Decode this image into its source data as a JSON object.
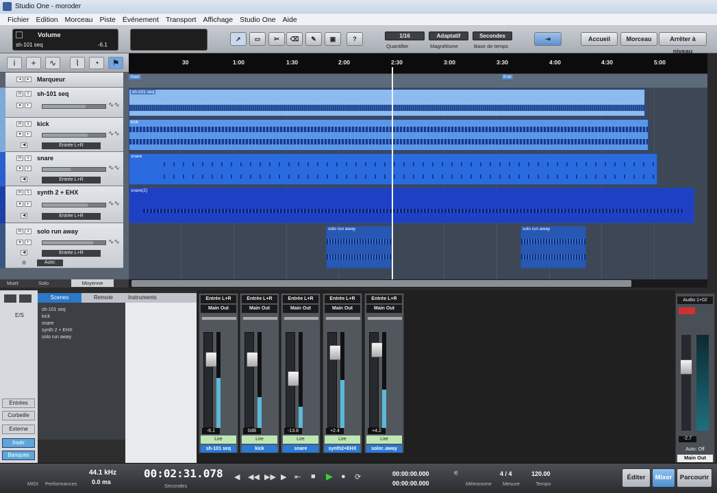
{
  "window": {
    "title": "Studio One - moroder"
  },
  "menu": [
    "Fichier",
    "Edition",
    "Morceau",
    "Piste",
    "Événement",
    "Transport",
    "Affichage",
    "Studio One",
    "Aide"
  ],
  "inspector": {
    "param": "Volume",
    "track": "sh-101 seq",
    "value": "-6.1"
  },
  "toolbar": {
    "quantize": "1/16",
    "quantize_label": "Quantifier",
    "snap": "Adaptatif",
    "snap_label": "Magnétisme",
    "timebase": "Secondes",
    "timebase_label": "Base de temps",
    "accueil": "Accueil",
    "morceau": "Morceau",
    "activer": "Arrêter à niveau"
  },
  "ruler": {
    "ticks": [
      "30",
      "1:00",
      "1:30",
      "2:00",
      "2:30",
      "3:00",
      "3:30",
      "4:00",
      "4:30",
      "5:00"
    ]
  },
  "markers": {
    "lane_label": "Marqueur",
    "start": "Start",
    "end": "End"
  },
  "tracks": [
    {
      "name": "sh-101 seq",
      "input": "",
      "color": "#7fa9d8",
      "volume": 0.68
    },
    {
      "name": "kick",
      "input": "Entrée L+R",
      "color": "#7fa9d8",
      "volume": 0.72
    },
    {
      "name": "snare",
      "input": "Entrée L+R",
      "color": "#2a5fd0",
      "volume": 0.45
    },
    {
      "name": "synth 2 + EHX",
      "input": "Entrée L+R",
      "color": "#1e3fa8",
      "volume": 0.72
    },
    {
      "name": "solo run away",
      "input": "Entrée L+R",
      "color": "#3a5580",
      "volume": 0.8
    }
  ],
  "track_footer": {
    "auto": "Auto:",
    "mute": "Muet",
    "solo": "Solo",
    "view": "Moyenne"
  },
  "clips": [
    {
      "label": "sh-101 seq"
    },
    {
      "label": "kick"
    },
    {
      "label": "snare"
    },
    {
      "label": "snare(2)"
    },
    {
      "label": "solo run away"
    }
  ],
  "browser": {
    "tabs": [
      "Scenes",
      "Remote",
      "Instruments"
    ],
    "io": "E/S",
    "items": [
      "sh-101 seq",
      "kick",
      "snare",
      "synth 2 + EHX",
      "solo run away"
    ],
    "side_buttons": [
      "Entrées",
      "Corbeille",
      "Externe",
      "Insér",
      "Banques"
    ]
  },
  "mixer": {
    "channels": [
      {
        "input": "Entrée L+R",
        "output": "Main Out",
        "value": "-6.1",
        "label": "Lire",
        "name": "sh-101 seq",
        "level": 0.52
      },
      {
        "input": "Entrée L+R",
        "output": "Main Out",
        "value": "0dB",
        "label": "Lire",
        "name": "kick",
        "level": 0.32
      },
      {
        "input": "Entrée L+R",
        "output": "Main Out",
        "value": "-13.8",
        "label": "Lire",
        "name": "snare",
        "level": 0.22
      },
      {
        "input": "Entrée L+R",
        "output": "Main Out",
        "value": "+2.4",
        "label": "Lire",
        "name": "synth2+EHX",
        "level": 0.5
      },
      {
        "input": "Entrée L+R",
        "output": "Main Out",
        "value": "+4.2",
        "label": "Lire",
        "name": "solor..away",
        "level": 0.4
      }
    ],
    "main": {
      "header": "Audio 1+02",
      "value": "-2.7",
      "auto": "Auto: Off",
      "name": "Main Out"
    }
  },
  "transport": {
    "midi": "MIDI",
    "perf": "Performances",
    "rate": "44.1 kHz",
    "latency": "0.0 ms",
    "time": "00:02:31.078",
    "time_label": "Secondes",
    "loop_start": "00:00:00.000",
    "loop_end": "00:00:00.000",
    "metronome": "Métronome",
    "signature": "4 / 4",
    "sig_label": "Mesure",
    "tempo": "120.00",
    "tempo_label": "Tempo",
    "edit": "Éditer",
    "mix": "Mixer",
    "browse": "Parcourir"
  }
}
